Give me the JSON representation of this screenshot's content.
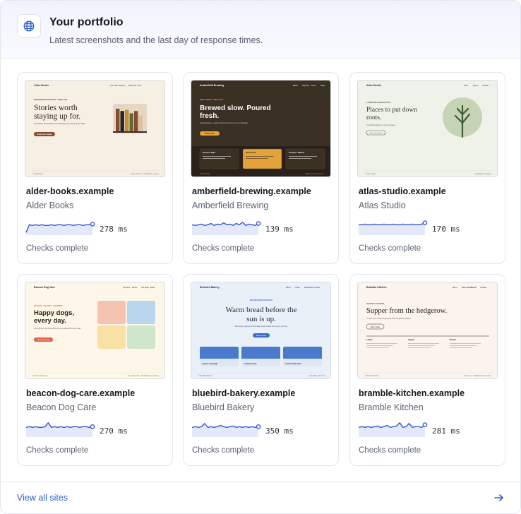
{
  "header": {
    "title": "Your portfolio",
    "subtitle": "Latest screenshots and the last day of response times.",
    "icon": "globe-icon"
  },
  "sites": [
    {
      "domain": "alder-books.example",
      "name": "Alder Books",
      "ms": "278 ms",
      "status": "Checks complete",
      "spark": [
        20,
        8,
        9,
        8,
        9,
        8,
        9,
        9,
        8,
        9,
        8,
        8,
        9,
        8,
        8,
        9,
        8,
        8,
        9,
        8,
        8,
        7
      ],
      "thumb": {
        "bg": "#f5efe4",
        "fg": "#2b2320",
        "accent": "#8a4a30",
        "brand": "Alder Books",
        "nav": [
          "Our Picks",
          "Events",
          "Book club",
          "Visit"
        ],
        "kicker": "INDEPENDENT BOOKSHOP · SINCE 1998",
        "headline": [
          "Stories worth",
          "staying up for."
        ],
        "body": "New fiction, local history and a reading nook with a good coffee.",
        "cta": "Browse the shelves",
        "footer_left": "© Alder Books",
        "footer_right": "Mon–Sat 9–6 · hello@alder.example"
      }
    },
    {
      "domain": "amberfield-brewing.example",
      "name": "Amberfield Brewing",
      "ms": "139 ms",
      "status": "Checks complete",
      "spark": [
        8,
        9,
        8,
        7,
        9,
        8,
        6,
        9,
        7,
        8,
        5,
        8,
        7,
        9,
        6,
        8,
        4,
        9,
        7,
        8,
        9,
        6
      ],
      "thumb": {
        "bg": "#3b3024",
        "fg": "#ffffff",
        "accent": "#e3a33a",
        "brand": "Amberfield Brewing",
        "nav": [
          "Beers",
          "Taproom",
          "Tours",
          "Shop"
        ],
        "kicker": "SMALL BATCH · SINCE 2012",
        "headline": [
          "Brewed slow. Poured",
          "fresh."
        ],
        "body": "Seasonal ales, a garden taproom and tours every Saturday.",
        "cta": "Book a tour",
        "beers": [
          "Harvest Pale",
          "Rauchbier",
          "Summer Wheat"
        ],
        "footer_left": "© Amberfield",
        "footer_right": "Taproom open Thu–Sun"
      }
    },
    {
      "domain": "atlas-studio.example",
      "name": "Atlas Studio",
      "ms": "170 ms",
      "status": "Checks complete",
      "spark": [
        8,
        8,
        7,
        8,
        8,
        7,
        8,
        8,
        7,
        8,
        8,
        7,
        8,
        8,
        7,
        8,
        8,
        7,
        8,
        8,
        7,
        5
      ],
      "thumb": {
        "bg": "#eef2e8",
        "fg": "#2b3a2a",
        "accent": "#4a6b40",
        "brand": "Atlas Studio",
        "nav": [
          "Work",
          "About",
          "Contact"
        ],
        "kicker": "LANDSCAPE ARCHITECTURE",
        "headline": [
          "Places to put down",
          "roots."
        ],
        "body": "Thoughtful gardens, shared spaces.",
        "cta": "See our projects",
        "footer_left": "© Atlas Studio",
        "footer_right": "studio@atlas.example"
      }
    },
    {
      "domain": "beacon-dog-care.example",
      "name": "Beacon Dog Care",
      "ms": "270 ms",
      "status": "Checks complete",
      "spark": [
        9,
        8,
        9,
        8,
        9,
        9,
        8,
        2,
        9,
        8,
        9,
        8,
        9,
        8,
        9,
        8,
        8,
        9,
        8,
        8,
        9,
        8
      ],
      "thumb": {
        "bg": "#fdf6e9",
        "fg": "#2b2418",
        "accent": "#e0664a",
        "brand": "Beacon Dog Care",
        "nav": [
          "Services",
          "Prices",
          "Our team",
          "Book"
        ],
        "kicker": "DAYCARE · WALKING · GROOMING",
        "headline": [
          "Happy dogs,",
          "every day."
        ],
        "body": "Small groups, big fields and a photo update after every walk.",
        "cta": "Book a trial day",
        "footer_left": "© Beacon Dog Care",
        "footer_right": "Open 7am–7pm · hello@beacon.example"
      }
    },
    {
      "domain": "bluebird-bakery.example",
      "name": "Bluebird Bakery",
      "ms": "350 ms",
      "status": "Checks complete",
      "spark": [
        9,
        8,
        9,
        8,
        3,
        9,
        8,
        9,
        8,
        6,
        8,
        9,
        8,
        7,
        9,
        8,
        9,
        8,
        9,
        8,
        9,
        8
      ],
      "thumb": {
        "bg": "#eaf0f8",
        "fg": "#1f2a44",
        "accent": "#3b6fc4",
        "brand": "Bluebird Bakery",
        "nav": [
          "Menu",
          "Order",
          "Wholesale",
          "Contact"
        ],
        "kicker": "NEIGHBOURHOOD BAKERY",
        "headline": [
          "Warm bread before the",
          "sun is up."
        ],
        "body": "Sourdough, pastries and birthday cakes baked fresh every morning.",
        "cta": "See the menu",
        "products": [
          "Country sourdough",
          "Cardamom buns",
          "Lemon drizzle cakes"
        ],
        "footer_left": "© Bluebird Bakery",
        "footer_right": "Open daily from 7am"
      }
    },
    {
      "domain": "bramble-kitchen.example",
      "name": "Bramble Kitchen",
      "ms": "281 ms",
      "status": "Checks complete",
      "spark": [
        9,
        8,
        9,
        8,
        9,
        8,
        7,
        9,
        8,
        6,
        9,
        8,
        7,
        2,
        9,
        8,
        3,
        9,
        8,
        8,
        9,
        5
      ],
      "thumb": {
        "bg": "#faf3ee",
        "fg": "#2a1f1c",
        "accent": "#9b3b3b",
        "brand": "Bramble Kitchen",
        "nav": [
          "Menu",
          "Reservations",
          "Private",
          "Contact"
        ],
        "kicker": "SEASONAL COOKING",
        "headline": [
          "Supper from the hedgerow."
        ],
        "body": "A short menu that changes with what the garden brings in.",
        "cta": "Book a table",
        "cols": [
          "Lunch",
          "Supper",
          "Drinks"
        ],
        "footer_left": "© Bramble Kitchen",
        "footer_right": "Wed–Sun · book@bramble.example"
      }
    }
  ],
  "footer": {
    "view_all": "View all sites",
    "arrow_icon": "arrow-right-icon"
  },
  "colors": {
    "accent_link": "#2f5fd0",
    "spark_line": "#3656d6",
    "spark_fill": "#e3e8fb"
  }
}
